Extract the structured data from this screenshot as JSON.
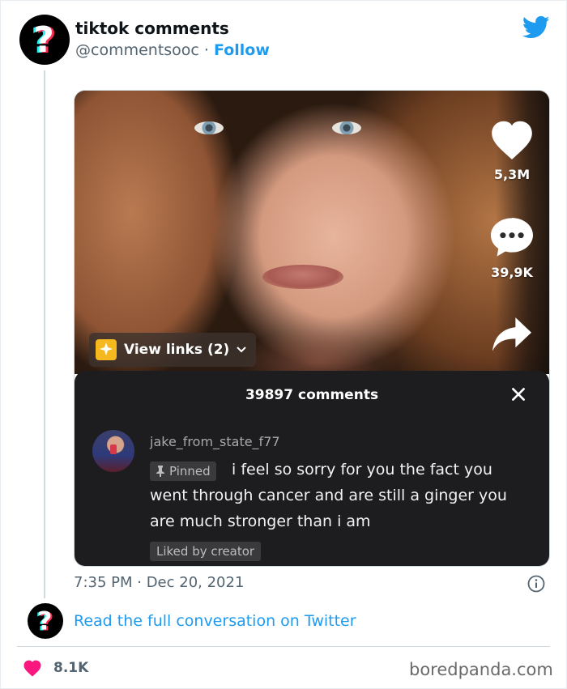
{
  "tweet": {
    "author_name": "tiktok comments",
    "handle": "@commentsooc",
    "separator": "·",
    "follow_label": "Follow",
    "timestamp": "7:35 PM · Dec 20, 2021",
    "read_more_label": "Read the full conversation on Twitter",
    "like_count": "8.1K"
  },
  "tiktok": {
    "likes": "5,3M",
    "comments_count_short": "39,9K",
    "view_links_label": "View links (2)",
    "panel_title": "39897 comments",
    "comment": {
      "username": "jake_from_state_f77",
      "pinned_label": "Pinned",
      "text": "i feel so sorry for you the fact you went through cancer and are still a ginger you are much stronger than i am",
      "liked_label": "Liked by creator"
    }
  },
  "watermark": "boredpanda.com",
  "colors": {
    "twitter_blue": "#1d9bf0",
    "like_red": "#f91880",
    "panel_dark": "#1d1d1f",
    "text_gray": "#536471"
  },
  "icons": [
    "question-mark-avatar-icon",
    "twitter-bird-icon",
    "heart-icon",
    "comment-bubble-icon",
    "share-arrow-icon",
    "close-icon",
    "pin-icon",
    "info-icon",
    "chevron-down-icon"
  ]
}
